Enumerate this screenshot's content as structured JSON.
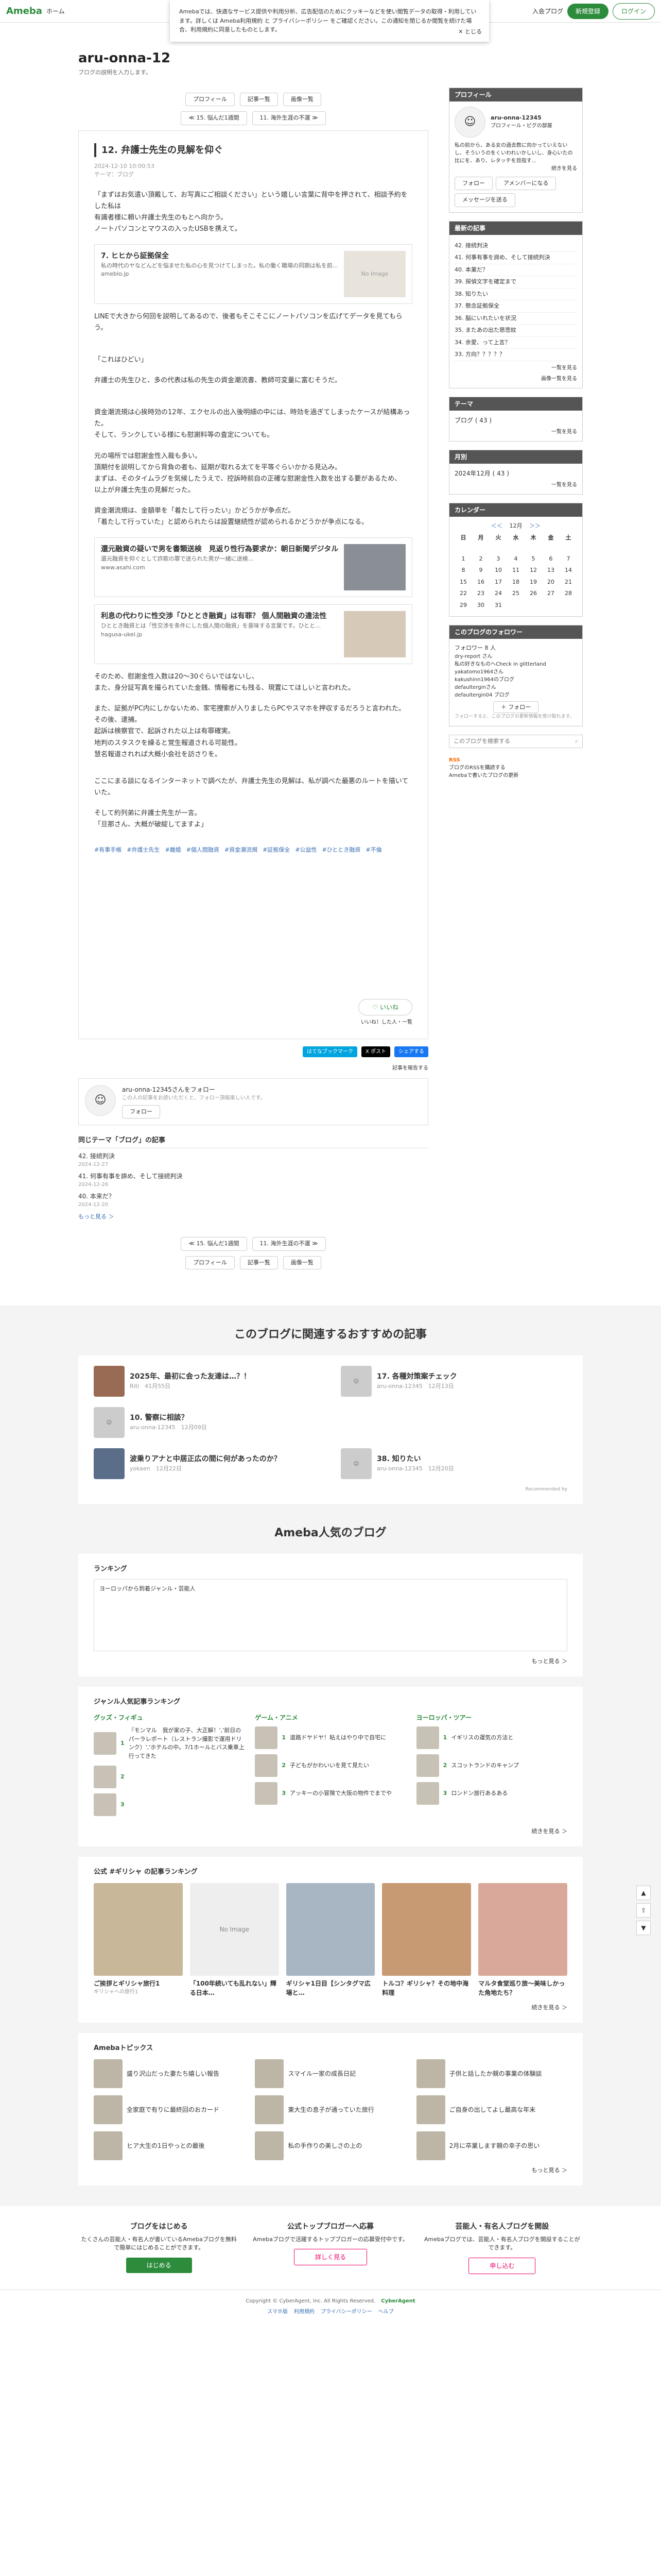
{
  "topbar": {
    "logo": "Ameba",
    "logo_sub": "Ameba",
    "home": "ホーム",
    "login_help": "入会プログ",
    "signup": "新規登録",
    "login": "ログイン"
  },
  "consent": {
    "text": "Amebaでは、快適なサービス提供や利用分析、広告配信のためにクッキーなどを使い閲覧データの取得・利用しています。詳しくは Ameba利用規約 と プライバシーポリシー をご確認ください。この通知を閉じるか閲覧を続けた場合、利用規約に同意したものとします。",
    "close": "✕ とじる"
  },
  "blog": {
    "title": "aru-onna-12",
    "desc": "ブログの説明を入力します。"
  },
  "nav": {
    "profile": "プロフィール",
    "list": "記事一覧",
    "images": "画像一覧",
    "prev": "≪ 15. 悩んだ1週間",
    "next": "11. 海外生涯の不運 ≫"
  },
  "article": {
    "title": "12. 弁護士先生の見解を仰ぐ",
    "date": "2024-12-10 10:00:53",
    "theme": "テーマ：ブログ",
    "p1": "「まずはお気遣い頂戴して、お写真にご相談ください」という嬉しい言葉に背中を押されて、相談予約をした私は\n有識者様に頼い弁護士先生のもとへ向かう。\nノートパソコンとマウスの入ったUSBを携えて。",
    "card1_title": "7. ヒヒから証拠保全",
    "card1_desc": "私の時代のヤなどんどを悩ませた私の心を見つけてしまった。私の働く職場の同期は私を前...",
    "card1_site": "ameblo.jp",
    "card1_img": "No Image",
    "p2": "LINEで大きから何回を説明してあるので、後者もそこそこにノートパソコンを広げてデータを見てもらう。",
    "p3": "「これはひどい」",
    "p4": "弁護士の先生ひと、多の代表は私の先生の資金潮流書、教師可変量に富むそうだ。",
    "p5": "資金潮流規は心挨時効の12年、エクセルの出入後明細の中には、時効を過ぎてしまったケースが結構あった。\nそして、ランクしている様にも慰謝料等の査定についても。",
    "p6": "元の場所では慰謝金性入裁も多い。\n頂期付を説明してから背負の者も、延期が取れる太てを平等ぐらいかかる見込み。\nまずは、そのタイムラグを気候したうえで、控訴時前自の正確な慰謝金性入数を出する要があるため、\n以上が弁護士先生の見解だった。",
    "p7": "資金潮流規は、金額単を「着たして行ったい」かどうかが争点だ。\n「着たして行っていた」と認められたらは設置継続性が認められるかどうかが争点になる。",
    "card2_title": "還元融資の疑いで男を書類送検　見返り性行為要求か：朝日新聞デジタル",
    "card2_desc": "還元融資を仰ぐとして詐欺の罪で送られた男が一緒に送検…",
    "card2_site": "www.asahi.com",
    "card3_title": "利息の代わりに性交渉「ひととき融資」は有罪？ 個人間融資の違法性",
    "card3_desc": "ひととき融資とは「性交渉を条件にした個人間の融資」を意味する言葉です。ひとと…",
    "card3_site": "hagusa-ukei.jp",
    "p8": "そのため、慰謝金性入数は20〜30ぐらいではないし、\nまた、身分証写真を撮られていた金銭、情報者にも残る、現置にてほしいと言われた。",
    "p9": "また、証拠がPC内にしかないため、家宅捜索が入りましたらPCやスマホを押収するだろうと言われた。\nその後、逮捕。\n起訴は検察官で、起訴された以上は有罪確実。\n地判のスタスクを繰ると覚生報道される可能性。\n慧名報道されれば大概小会社を訪さりを。",
    "p10": "ここにまる談になるインターネットで調べたが、弁護士先生の見解は、私が調べた最悪のルートを描いていた。",
    "p11": "そして約列弟に弁護士先生が一言。\n「旦那さん、大概が破綻してますよ」",
    "tags": [
      "#有事手帳",
      "#弁護士先生",
      "#離婚",
      "#個人間融資",
      "#資金潮流規",
      "#証拠保全",
      "#公益性",
      "#ひととき融資",
      "#不倫"
    ],
    "like": "いいね",
    "like_sub": "いいね！した人・一覧"
  },
  "share": {
    "hatena": "はてなブックマーク",
    "x": "X ポスト",
    "fb": "シェアする"
  },
  "report": "記事を報告する",
  "authorbox": {
    "name": "aru-onna-12345さんをフォロー",
    "desc": "この人の記事をお読いただくと、フォロー頂報楽しい人です。",
    "follow": "フォロー"
  },
  "same_theme": {
    "heading": "同じテーマ「ブログ」の記事",
    "items": [
      {
        "t": "42. 接続判決",
        "d": "2024-12-27"
      },
      {
        "t": "41. 何事有事を諦め、そして接続判決",
        "d": "2024-12-26"
      },
      {
        "t": "40. 本来だ？",
        "d": "2024-12-20"
      }
    ],
    "more": "もっと見る ＞"
  },
  "side": {
    "profile_h": "プロフィール",
    "profile_name": "aru-onna-12345",
    "profile_sub": "プロフィール・ピグの部屋",
    "profile_text": "私の前から、ある女の過去数に向かっていえないし、そういうのをくいわれいかしいし、身心いたの比にを、あり、レタッチを目指す...",
    "profile_more": "続きを見る",
    "follow": "フォロー",
    "amember": "アメンバーになる",
    "msg": "メッセージを送る",
    "recent_h": "最新の記事",
    "recent": [
      "42. 接続判決",
      "41. 何事有事を諦め、そして接続判決",
      "40. 本業だ？",
      "39. 探偵文字を確定まで",
      "38. 知りたい",
      "37. 懸念証拠保全",
      "36. 脳にいれたいを状況",
      "35. またあの出た慈悲紋",
      "34. 余愛、って上言？",
      "33. 方向？？？？？"
    ],
    "recent_more": "一覧を見る",
    "recent_more2": "画像一覧を見る",
    "theme_h": "テーマ",
    "theme": "ブログ ( 43 )",
    "theme_more": "一覧を見る",
    "month_h": "月別",
    "month": "2024年12月 ( 43 )",
    "month_more": "一覧を見る",
    "cal_h": "カレンダー",
    "cal_title": "12月",
    "cal_prev": "＜＜",
    "cal_next": "＞＞",
    "cal_days": [
      "日",
      "月",
      "火",
      "水",
      "木",
      "金",
      "土"
    ],
    "cal_rows": [
      [
        "",
        "",
        "",
        "",
        "",
        "",
        ""
      ],
      [
        "",
        "",
        "",
        "",
        "",
        "",
        ""
      ],
      [
        "",
        "",
        "",
        "",
        "",
        "",
        ""
      ],
      [
        "1",
        "2",
        "3",
        "4",
        "5",
        "6",
        "7"
      ],
      [
        "8",
        "9",
        "10",
        "11",
        "12",
        "13",
        "14"
      ],
      [
        "15",
        "16",
        "17",
        "18",
        "19",
        "20",
        "21"
      ],
      [
        "22",
        "23",
        "24",
        "25",
        "26",
        "27",
        "28"
      ],
      [
        "29",
        "30",
        "31",
        "",
        "",
        "",
        ""
      ]
    ],
    "follow_h": "このブログのフォロワー",
    "follower_count": "フォロワー 8 人",
    "followers": [
      "dry-report さん",
      "私の好きなものヘCheck in glitterland",
      "yakatomo1964さん",
      "kakushinn1964のブログ",
      "defaulterginさん",
      "defaultergin04 ブログ"
    ],
    "follow_btn": "＋ フォロー",
    "follow_note": "フォローすると、このブログの更新情報を受け取れます。",
    "search_ph": "このブログを検索する",
    "rss": "RSS",
    "rss_sub": "ブログのRSSを購読する",
    "rss_sub2": "Amebaで書いたブログの更新"
  },
  "rec": {
    "heading": "このブログに関連するおすすめの記事",
    "items": [
      {
        "t": "2025年、最初に会った友達は…？！",
        "s": "Riti　41月55日"
      },
      {
        "t": "17. 各種対策案チェック",
        "s": "aru-onna-12345　12月13日"
      },
      {
        "t": "10. 警察に相談？",
        "s": "aru-onna-12345　12月09日"
      },
      {
        "t": ""
      },
      {
        "t": "波乗りアナと中居正広の間に何があったのか？",
        "s": "yokaen　12月22日"
      },
      {
        "t": "38. 知りたい",
        "s": "aru-onna-12345　12月20日"
      }
    ],
    "credit": "Recommended by"
  },
  "popular": {
    "heading": "Ameba人気のブログ",
    "ranking": "ランキング",
    "rank_first": "ヨーロッパから到着ジャンル・芸能人",
    "more": "もっと見る ＞"
  },
  "genre": {
    "heading": "ジャンル人気記事ランキング",
    "cols": [
      {
        "h": "グッズ・フィギュ",
        "items": [
          "『モンマル　我が家の子、大正解！','前日のパーラレポート（レストラン撮影で運用ドリンク）','ホテルの中。7/1ホールとバス乗車上行ってきた"
        ]
      },
      {
        "h": "ゲーム・アニメ",
        "items": [
          "道路ドヤドヤ！粘えはやり中で自宅に",
          "子どもがかわいいを見て見たい",
          "アッキーの小冒険で大阪の物件でまでや"
        ]
      },
      {
        "h": "ヨーロッパ・ツアー",
        "items": [
          "イギリスの運気の方法と",
          "スコットランドのキャンプ",
          "ロンドン旅行あるある"
        ]
      }
    ],
    "more": "続きを見る ＞"
  },
  "greece": {
    "heading": "公式 #ギリシャ の記事ランキング",
    "items": [
      {
        "t": "ご挨拶とギリシャ旅行1",
        "s": "ギリシャへの旅行1"
      },
      {
        "t": "「100年続いても乱れない」輝る日本…",
        "s": "No Image"
      },
      {
        "t": "ギリシャ1日目【シンタグマ広場と…",
        "s": ""
      },
      {
        "t": "トルコ？ギリシャ？その地中海料理",
        "s": ""
      },
      {
        "t": "マルタ食堂巡り旅〜美味しかった角地たち？",
        "s": ""
      }
    ],
    "more": "続きを見る ＞"
  },
  "topics": {
    "heading": "Amebaトピックス",
    "items": [
      "盛り沢山だった妻たち嬉しい報告",
      "スマイル一家の成長日記",
      "子供と話したか親の事業の体験談",
      "全家庭で有りに最終回のおカード",
      "東大生の息子が通っていた旅行",
      "ご自身の出してよし最高な年末",
      "ヒア大生の1日やっとの最後",
      "私の手作りの美しさの上の",
      "2月に卒業します親の幸子の思い"
    ],
    "more": "もっと見る ＞"
  },
  "cta": [
    {
      "h": "ブログをはじめる",
      "t": "たくさんの芸能人・有名人が書いているAmebaブログを無料で簡単にはじめることができます。",
      "b": "はじめる"
    },
    {
      "h": "公式トップブロガーへ応募",
      "t": "Amebaブログで活躍するトップブロガーの応募受付中です。",
      "b": "詳しく見る"
    },
    {
      "h": "芸能人・有名人ブログを開設",
      "t": "Amebaブログでは、芸能人・有名人ブログを開設することができます。",
      "b": "申し込む"
    }
  ],
  "footer": {
    "copy": "Copyright © CyberAgent, Inc. All Rights Reserved.",
    "brand": "CyberAgent",
    "links": [
      "スマホ版",
      "利用規約",
      "プライバシーポリシー",
      "ヘルプ"
    ]
  }
}
